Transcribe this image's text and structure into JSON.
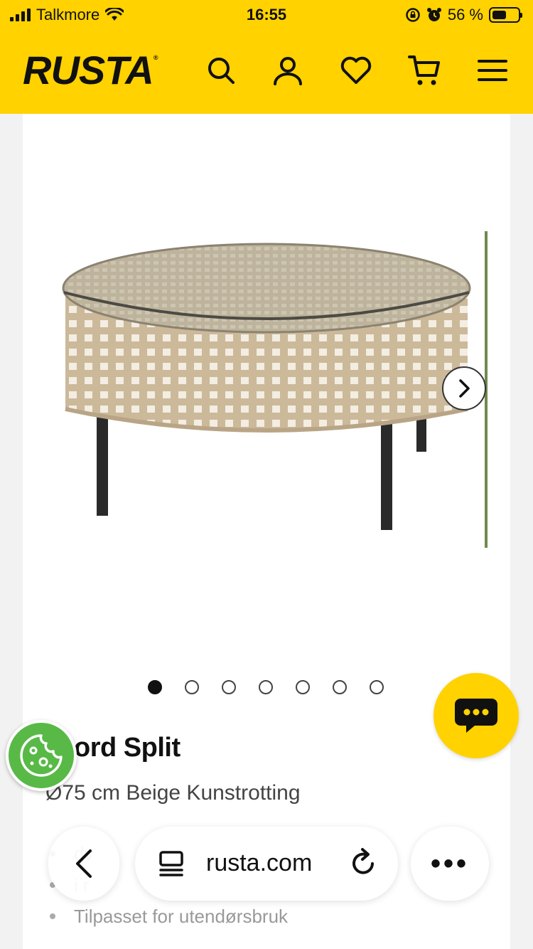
{
  "status_bar": {
    "carrier": "Talkmore",
    "time": "16:55",
    "battery_text": "56 %",
    "battery_level": 0.56
  },
  "header": {
    "logo": "RUSTA",
    "brand_color": "#ffd200",
    "icons": [
      "search-icon",
      "account-icon",
      "heart-icon",
      "cart-icon",
      "menu-icon"
    ]
  },
  "gallery": {
    "image_count": 7,
    "active_index": 0
  },
  "product": {
    "title": "ord Split",
    "subtitle": "Ø75 cm Beige Kunstrotting",
    "bullets": [
      "dv",
      "i r",
      "Tilpasset for utendørsbruk"
    ]
  },
  "browser": {
    "url": "rusta.com",
    "more_label": "•••"
  },
  "colors": {
    "cookie_button": "#58b947",
    "chat_button": "#ffd200"
  }
}
